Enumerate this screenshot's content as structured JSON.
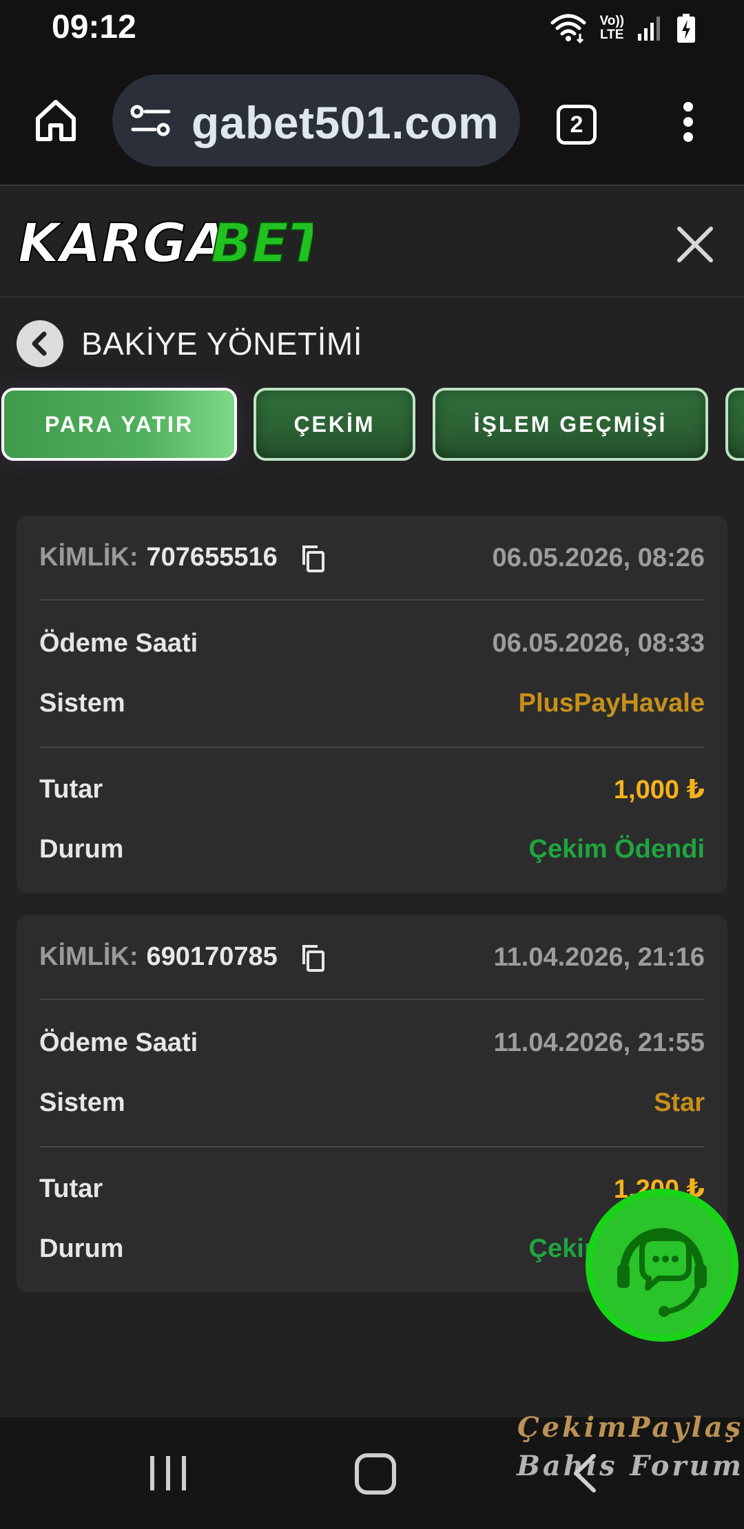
{
  "status_bar": {
    "time": "09:12",
    "network_label_top": "Vo))",
    "network_label_bottom": "LTE",
    "battery_level": 0.65
  },
  "browser": {
    "url": "gabet501.com",
    "tab_count": "2"
  },
  "site": {
    "logo_text_white": "KARGA",
    "logo_text_green": "BET",
    "logo_colors": {
      "white": "#ffffff",
      "green": "#22c122"
    }
  },
  "page": {
    "title": "BAKİYE YÖNETİMİ"
  },
  "tabs": [
    {
      "label": "PARA YATIR",
      "active": true
    },
    {
      "label": "ÇEKİM",
      "active": false
    },
    {
      "label": "İŞLEM GEÇMİŞİ",
      "active": false
    }
  ],
  "transactions": [
    {
      "id_label": "KİMLİK:",
      "id": "707655516",
      "created": "06.05.2026, 08:26",
      "payment_time_label": "Ödeme Saati",
      "payment_time": "06.05.2026, 08:33",
      "system_label": "Sistem",
      "system": "PlusPayHavale",
      "amount_label": "Tutar",
      "amount": "1,000 ₺",
      "status_label": "Durum",
      "status": "Çekim Ödendi"
    },
    {
      "id_label": "KİMLİK:",
      "id": "690170785",
      "created": "11.04.2026, 21:16",
      "payment_time_label": "Ödeme Saati",
      "payment_time": "11.04.2026, 21:55",
      "system_label": "Sistem",
      "system": "Star",
      "amount_label": "Tutar",
      "amount": "1,200 ₺",
      "status_label": "Durum",
      "status": "Çekim Ödendi"
    }
  ],
  "watermark": {
    "line1": "ÇekimPaylaş",
    "line2": "Bahis Forum"
  },
  "colors": {
    "background": "#222222",
    "card": "#2c2c2c",
    "system_value": "#c8901a",
    "amount_value": "#f5b21c",
    "status_value": "#1fa541",
    "chat_button": "#2ac32a"
  }
}
